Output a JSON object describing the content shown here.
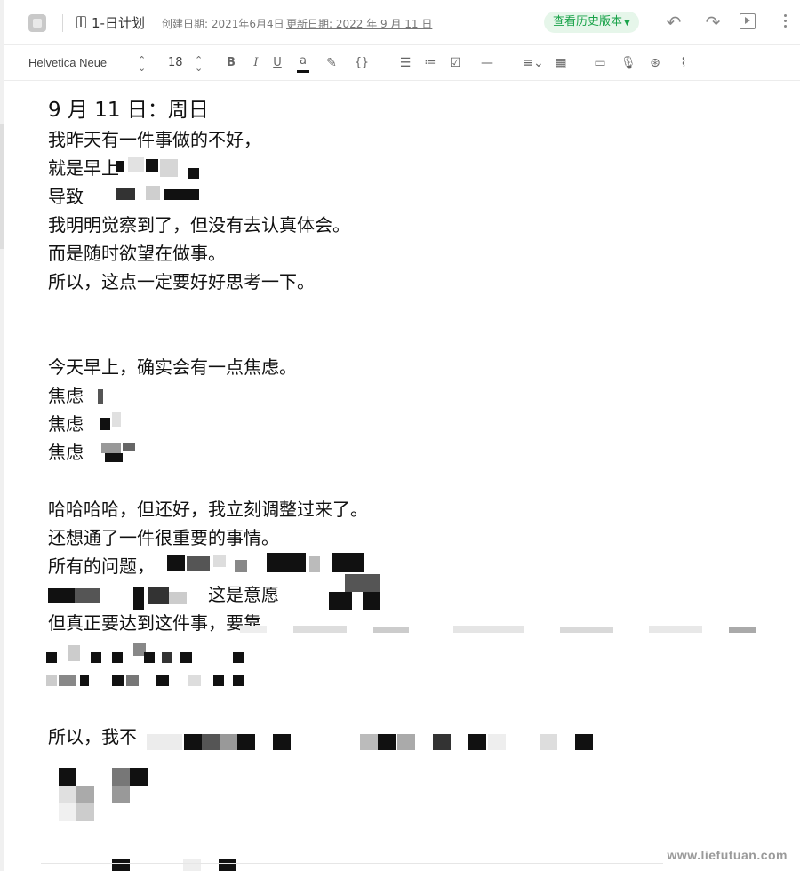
{
  "header": {
    "notebook_title": "1-日计划",
    "created": "创建日期: 2021年6月4日",
    "updated": "更新日期: 2022 年 9 月 11 日",
    "history_button": "查看历史版本"
  },
  "toolbar": {
    "font_name": "Helvetica Neue",
    "font_size": "18",
    "bold": "B",
    "italic": "I",
    "underline": "U",
    "text_color": "a",
    "code": "{}"
  },
  "content": {
    "title": "9 月 11 日：周日",
    "lines": [
      "我昨天有一件事做的不好，",
      "就是早上",
      "导致",
      "我明明觉察到了，但没有去认真体会。",
      "而是随时欲望在做事。",
      "所以，这点一定要好好思考一下。",
      "今天早上，确实会有一点焦虑。",
      "焦虑",
      "焦虑",
      "焦虑",
      "哈哈哈哈，但还好，我立刻调整过来了。",
      "还想通了一件很重要的事情。",
      "所有的问题，",
      "这是意愿",
      "但真正要达到这件事，要靠",
      "所以，我不"
    ]
  },
  "watermark": "www.liefutuan.com",
  "colors": {
    "history_bg": "#e6f6ea",
    "history_text": "#1aa34a"
  }
}
